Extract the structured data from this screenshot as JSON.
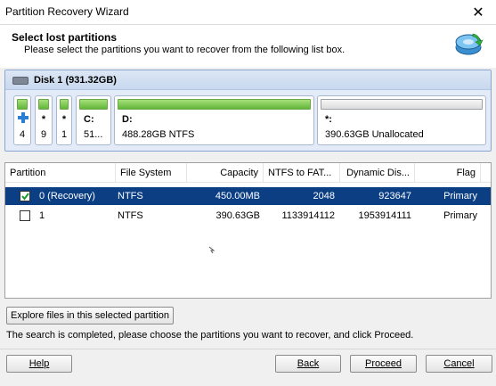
{
  "window": {
    "title": "Partition Recovery Wizard",
    "close_glyph": "✕"
  },
  "header": {
    "title": "Select lost partitions",
    "subtitle": "Please select the partitions you want to recover from the following list box.",
    "icon": "wizard-disk-icon"
  },
  "disk": {
    "label": "Disk 1 (931.32GB)",
    "partitions": [
      {
        "name": "",
        "info": "4",
        "kind": "used",
        "icon": "plus-icon"
      },
      {
        "name": "*",
        "info": "9",
        "kind": "used"
      },
      {
        "name": "*",
        "info": "1",
        "kind": "used"
      },
      {
        "name": "C:",
        "info": "51...",
        "kind": "used"
      },
      {
        "name": "D:",
        "info": "488.28GB NTFS",
        "kind": "used"
      },
      {
        "name": "*:",
        "info": "390.63GB Unallocated",
        "kind": "unallocated"
      }
    ]
  },
  "table": {
    "columns": [
      "Partition",
      "File System",
      "Capacity",
      "NTFS to FAT...",
      "Dynamic Dis...",
      "Flag"
    ],
    "rows": [
      {
        "checked": true,
        "selected": true,
        "partition": "0 (Recovery)",
        "file_system": "NTFS",
        "capacity": "450.00MB",
        "ntfs_to_fat": "2048",
        "dynamic_disk": "923647",
        "flag": "Primary"
      },
      {
        "checked": false,
        "selected": false,
        "partition": "1",
        "file_system": "NTFS",
        "capacity": "390.63GB",
        "ntfs_to_fat": "1133914112",
        "dynamic_disk": "1953914111",
        "flag": "Primary"
      }
    ]
  },
  "buttons": {
    "explore": "Explore files in this selected partition",
    "help": "Help",
    "back": "Back",
    "proceed": "Proceed",
    "cancel": "Cancel"
  },
  "status": "The search is completed, please choose the partitions you want to recover, and click Proceed.",
  "colors": {
    "selection": "#0b3e83",
    "partition_used": "#62b53a",
    "disk_panel": "#e2ebf7"
  }
}
